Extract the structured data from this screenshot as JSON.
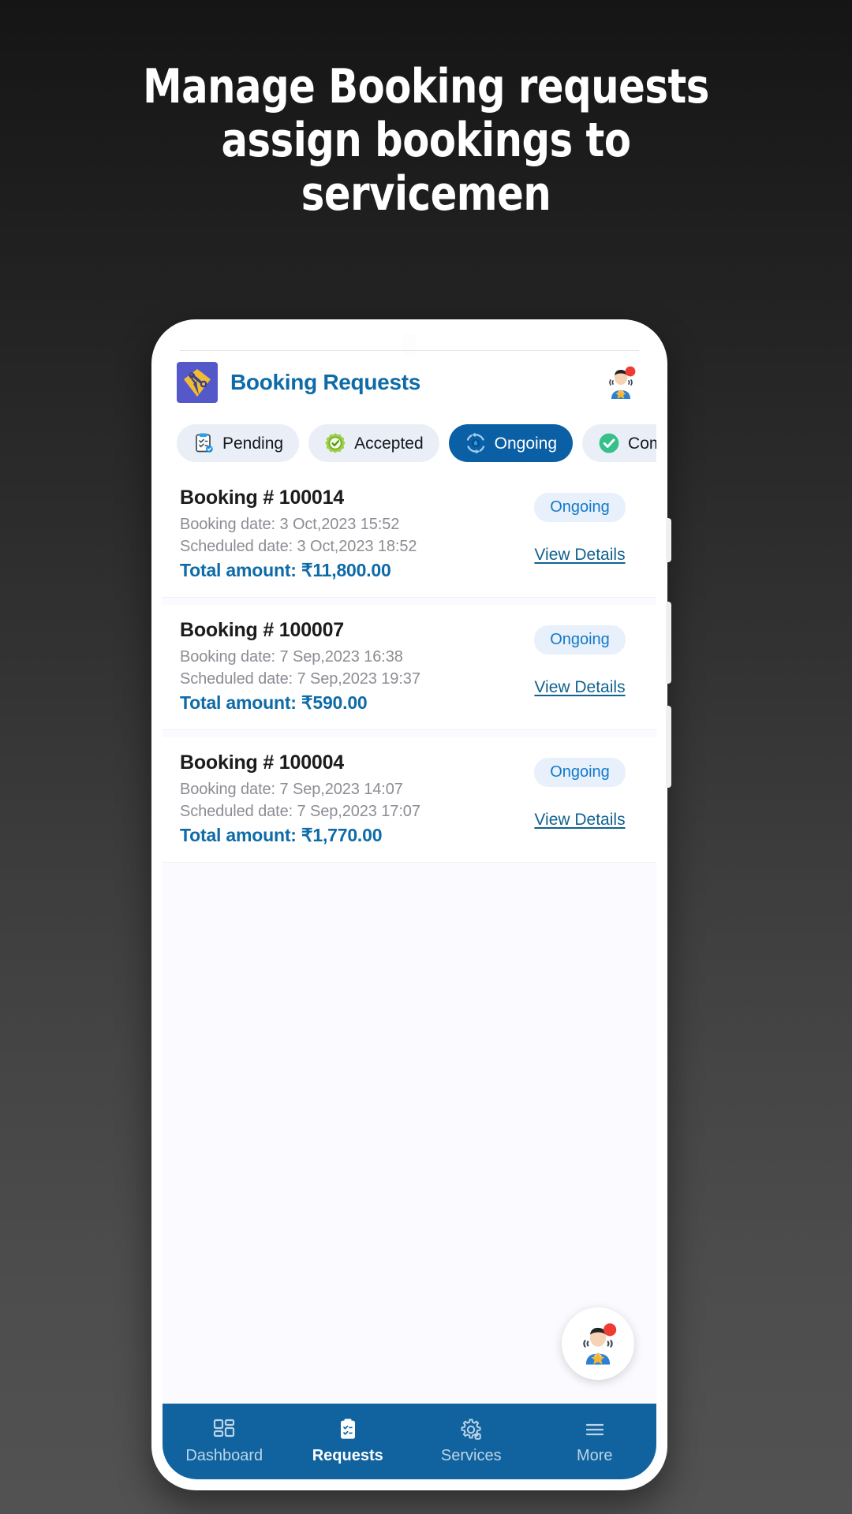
{
  "promo": {
    "headline_lines": [
      "Manage Booking requests",
      "assign bookings to",
      "servicemen"
    ],
    "text_color": "#ffffff",
    "background": "dark-gray-gradient"
  },
  "app": {
    "logo_icon": "diamond-wrench-logo-icon",
    "title": "Booking Requests",
    "title_color": "#0e6ba8",
    "header_avatar_icon": "serviceman-avatar-notification-icon"
  },
  "tabs": {
    "active_index": 2,
    "items": [
      {
        "label": "Pending",
        "icon": "clipboard-checklist-icon",
        "active": false
      },
      {
        "label": "Accepted",
        "icon": "green-rosette-check-icon",
        "active": false
      },
      {
        "label": "Ongoing",
        "icon": "blue-refresh-cycle-icon",
        "active": true
      },
      {
        "label": "Com",
        "icon": "green-circle-check-icon",
        "active": false
      }
    ],
    "active_bg": "#0b5fa5",
    "inactive_bg": "#eaeff7"
  },
  "list": {
    "labels": {
      "booking_date": "Booking date:",
      "scheduled_date": "Scheduled date:",
      "total_amount": "Total amount:",
      "view_details": "View Details"
    },
    "bookings": [
      {
        "title": "Booking # 100014",
        "booking_date": "Booking date:  3 Oct,2023 15:52",
        "scheduled_date": "Scheduled date: 3 Oct,2023 18:52",
        "total": "Total amount: ₹11,800.00",
        "status": "Ongoing",
        "action": "View Details"
      },
      {
        "title": "Booking # 100007",
        "booking_date": "Booking date:  7 Sep,2023 16:38",
        "scheduled_date": "Scheduled date: 7 Sep,2023 19:37",
        "total": "Total amount: ₹590.00",
        "status": "Ongoing",
        "action": "View Details"
      },
      {
        "title": "Booking # 100004",
        "booking_date": "Booking date:  7 Sep,2023 14:07",
        "scheduled_date": "Scheduled date: 7 Sep,2023 17:07",
        "total": "Total amount: ₹1,770.00",
        "status": "Ongoing",
        "action": "View Details"
      }
    ],
    "status_color": "#1479c9",
    "status_bg": "#e7f0fb",
    "amount_color": "#0e6ba8"
  },
  "fab": {
    "icon": "serviceman-avatar-notification-icon"
  },
  "bottom_nav": {
    "background": "#11639f",
    "active_index": 1,
    "items": [
      {
        "label": "Dashboard",
        "icon": "grid-dashboard-icon",
        "active": false
      },
      {
        "label": "Requests",
        "icon": "clipboard-requests-icon",
        "active": true
      },
      {
        "label": "Services",
        "icon": "gear-services-icon",
        "active": false
      },
      {
        "label": "More",
        "icon": "hamburger-more-icon",
        "active": false
      }
    ]
  }
}
